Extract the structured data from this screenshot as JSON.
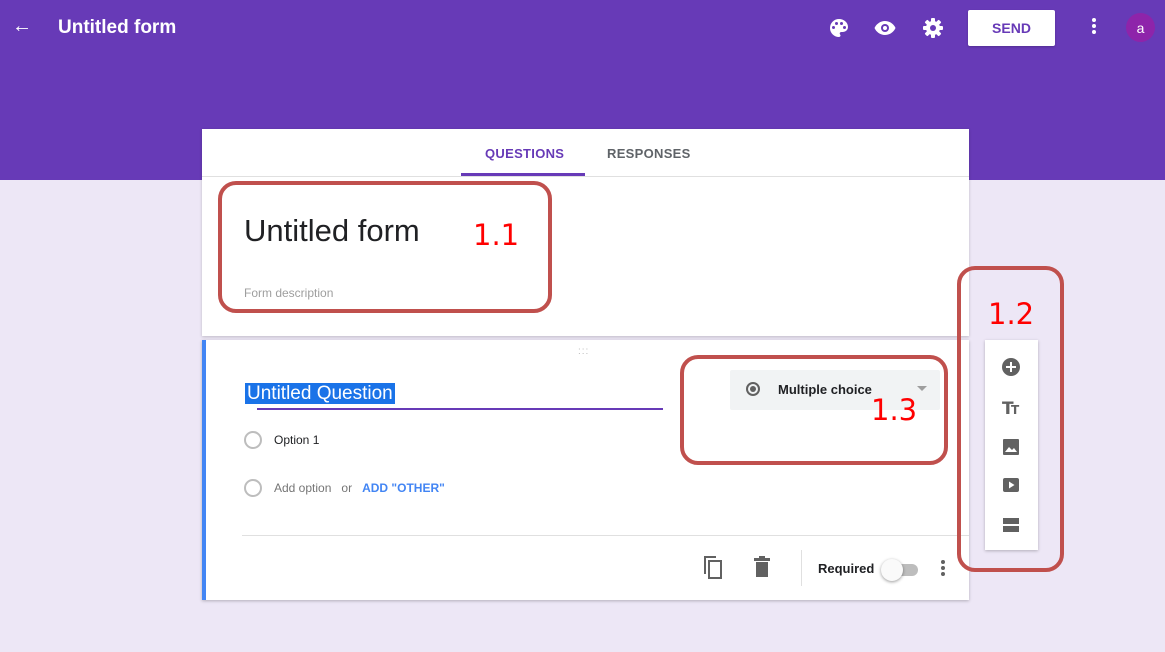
{
  "header": {
    "title": "Untitled form",
    "send_label": "SEND",
    "avatar_letter": "a",
    "icons": [
      "arrow-back-icon",
      "palette-icon",
      "eye-icon",
      "gear-icon",
      "more-vert-icon"
    ],
    "colors": {
      "brand": "#673ab7",
      "background": "#ede7f6"
    }
  },
  "tabs": [
    {
      "label": "QUESTIONS",
      "active": true
    },
    {
      "label": "RESPONSES",
      "active": false
    }
  ],
  "form": {
    "title": "Untitled form",
    "description_placeholder": "Form description"
  },
  "question": {
    "title": "Untitled Question",
    "type": "Multiple choice",
    "options": [
      "Option 1"
    ],
    "add_option": "Add option",
    "or": "or",
    "add_other": "ADD \"OTHER\"",
    "required_label": "Required",
    "required": false
  },
  "side_toolbar": {
    "items": [
      "add-question-icon",
      "title-text-icon",
      "image-icon",
      "video-icon",
      "section-icon"
    ]
  },
  "annotations": {
    "label_1": "1.1",
    "label_2": "1.2",
    "label_3": "1.3",
    "color": "#c0504d"
  }
}
